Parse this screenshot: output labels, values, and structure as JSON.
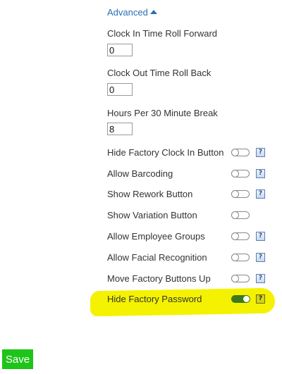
{
  "advanced": {
    "label": "Advanced"
  },
  "fields": [
    {
      "label": "Clock In Time Roll Forward",
      "value": "0"
    },
    {
      "label": "Clock Out Time Roll Back",
      "value": "0"
    },
    {
      "label": "Hours Per 30 Minute Break",
      "value": "8"
    }
  ],
  "toggles": [
    {
      "label": "Hide Factory Clock In Button",
      "on": false,
      "help": true
    },
    {
      "label": "Allow Barcoding",
      "on": false,
      "help": true
    },
    {
      "label": "Show Rework Button",
      "on": false,
      "help": true
    },
    {
      "label": "Show Variation Button",
      "on": false,
      "help": false
    },
    {
      "label": "Allow Employee Groups",
      "on": false,
      "help": true
    },
    {
      "label": "Allow Facial Recognition",
      "on": false,
      "help": true
    },
    {
      "label": "Move Factory Buttons Up",
      "on": false,
      "help": true
    },
    {
      "label": "Hide Factory Password",
      "on": true,
      "help": true
    }
  ],
  "help_glyph": "?",
  "save_button": {
    "label": "Save"
  },
  "colors": {
    "link": "#2a6db6",
    "toggle_on": "#3d7a1d",
    "highlight": "#f4f200",
    "save": "#1ec418"
  }
}
